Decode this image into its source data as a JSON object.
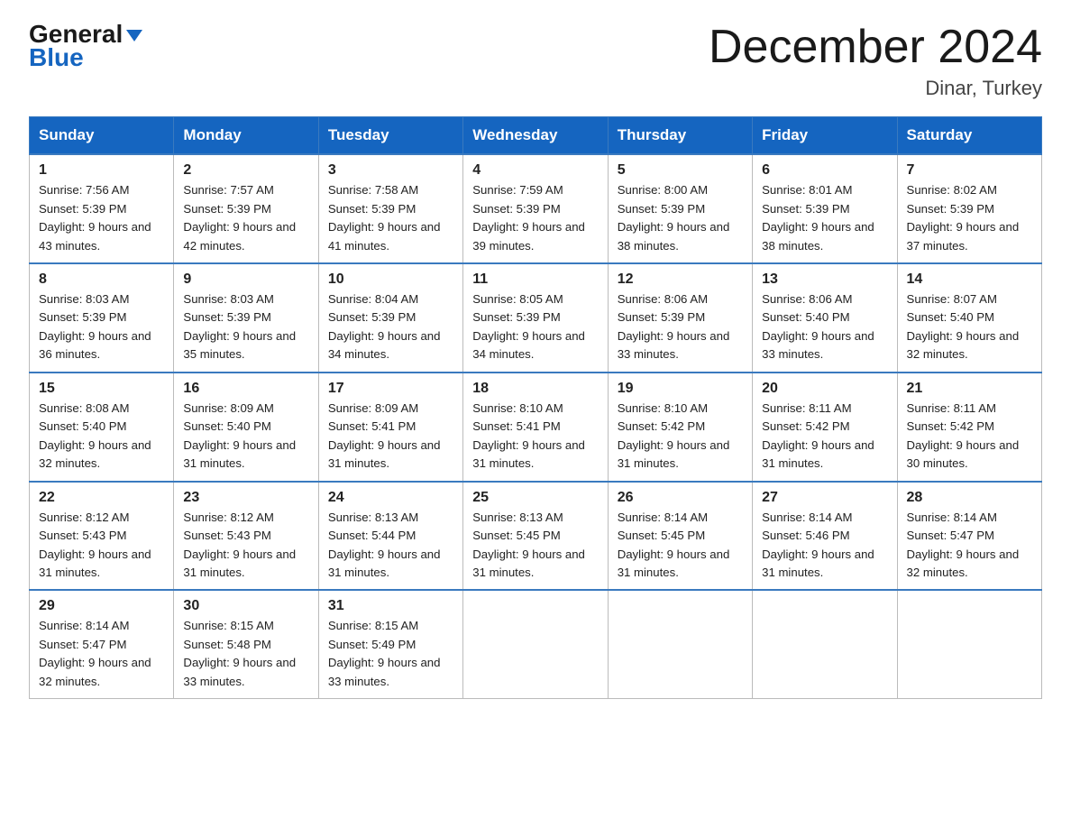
{
  "header": {
    "logo_line1": "General",
    "logo_line2": "Blue",
    "title": "December 2024",
    "subtitle": "Dinar, Turkey"
  },
  "days_of_week": [
    "Sunday",
    "Monday",
    "Tuesday",
    "Wednesday",
    "Thursday",
    "Friday",
    "Saturday"
  ],
  "weeks": [
    [
      {
        "day": "1",
        "sunrise": "7:56 AM",
        "sunset": "5:39 PM",
        "daylight": "9 hours and 43 minutes."
      },
      {
        "day": "2",
        "sunrise": "7:57 AM",
        "sunset": "5:39 PM",
        "daylight": "9 hours and 42 minutes."
      },
      {
        "day": "3",
        "sunrise": "7:58 AM",
        "sunset": "5:39 PM",
        "daylight": "9 hours and 41 minutes."
      },
      {
        "day": "4",
        "sunrise": "7:59 AM",
        "sunset": "5:39 PM",
        "daylight": "9 hours and 39 minutes."
      },
      {
        "day": "5",
        "sunrise": "8:00 AM",
        "sunset": "5:39 PM",
        "daylight": "9 hours and 38 minutes."
      },
      {
        "day": "6",
        "sunrise": "8:01 AM",
        "sunset": "5:39 PM",
        "daylight": "9 hours and 38 minutes."
      },
      {
        "day": "7",
        "sunrise": "8:02 AM",
        "sunset": "5:39 PM",
        "daylight": "9 hours and 37 minutes."
      }
    ],
    [
      {
        "day": "8",
        "sunrise": "8:03 AM",
        "sunset": "5:39 PM",
        "daylight": "9 hours and 36 minutes."
      },
      {
        "day": "9",
        "sunrise": "8:03 AM",
        "sunset": "5:39 PM",
        "daylight": "9 hours and 35 minutes."
      },
      {
        "day": "10",
        "sunrise": "8:04 AM",
        "sunset": "5:39 PM",
        "daylight": "9 hours and 34 minutes."
      },
      {
        "day": "11",
        "sunrise": "8:05 AM",
        "sunset": "5:39 PM",
        "daylight": "9 hours and 34 minutes."
      },
      {
        "day": "12",
        "sunrise": "8:06 AM",
        "sunset": "5:39 PM",
        "daylight": "9 hours and 33 minutes."
      },
      {
        "day": "13",
        "sunrise": "8:06 AM",
        "sunset": "5:40 PM",
        "daylight": "9 hours and 33 minutes."
      },
      {
        "day": "14",
        "sunrise": "8:07 AM",
        "sunset": "5:40 PM",
        "daylight": "9 hours and 32 minutes."
      }
    ],
    [
      {
        "day": "15",
        "sunrise": "8:08 AM",
        "sunset": "5:40 PM",
        "daylight": "9 hours and 32 minutes."
      },
      {
        "day": "16",
        "sunrise": "8:09 AM",
        "sunset": "5:40 PM",
        "daylight": "9 hours and 31 minutes."
      },
      {
        "day": "17",
        "sunrise": "8:09 AM",
        "sunset": "5:41 PM",
        "daylight": "9 hours and 31 minutes."
      },
      {
        "day": "18",
        "sunrise": "8:10 AM",
        "sunset": "5:41 PM",
        "daylight": "9 hours and 31 minutes."
      },
      {
        "day": "19",
        "sunrise": "8:10 AM",
        "sunset": "5:42 PM",
        "daylight": "9 hours and 31 minutes."
      },
      {
        "day": "20",
        "sunrise": "8:11 AM",
        "sunset": "5:42 PM",
        "daylight": "9 hours and 31 minutes."
      },
      {
        "day": "21",
        "sunrise": "8:11 AM",
        "sunset": "5:42 PM",
        "daylight": "9 hours and 30 minutes."
      }
    ],
    [
      {
        "day": "22",
        "sunrise": "8:12 AM",
        "sunset": "5:43 PM",
        "daylight": "9 hours and 31 minutes."
      },
      {
        "day": "23",
        "sunrise": "8:12 AM",
        "sunset": "5:43 PM",
        "daylight": "9 hours and 31 minutes."
      },
      {
        "day": "24",
        "sunrise": "8:13 AM",
        "sunset": "5:44 PM",
        "daylight": "9 hours and 31 minutes."
      },
      {
        "day": "25",
        "sunrise": "8:13 AM",
        "sunset": "5:45 PM",
        "daylight": "9 hours and 31 minutes."
      },
      {
        "day": "26",
        "sunrise": "8:14 AM",
        "sunset": "5:45 PM",
        "daylight": "9 hours and 31 minutes."
      },
      {
        "day": "27",
        "sunrise": "8:14 AM",
        "sunset": "5:46 PM",
        "daylight": "9 hours and 31 minutes."
      },
      {
        "day": "28",
        "sunrise": "8:14 AM",
        "sunset": "5:47 PM",
        "daylight": "9 hours and 32 minutes."
      }
    ],
    [
      {
        "day": "29",
        "sunrise": "8:14 AM",
        "sunset": "5:47 PM",
        "daylight": "9 hours and 32 minutes."
      },
      {
        "day": "30",
        "sunrise": "8:15 AM",
        "sunset": "5:48 PM",
        "daylight": "9 hours and 33 minutes."
      },
      {
        "day": "31",
        "sunrise": "8:15 AM",
        "sunset": "5:49 PM",
        "daylight": "9 hours and 33 minutes."
      },
      null,
      null,
      null,
      null
    ]
  ]
}
